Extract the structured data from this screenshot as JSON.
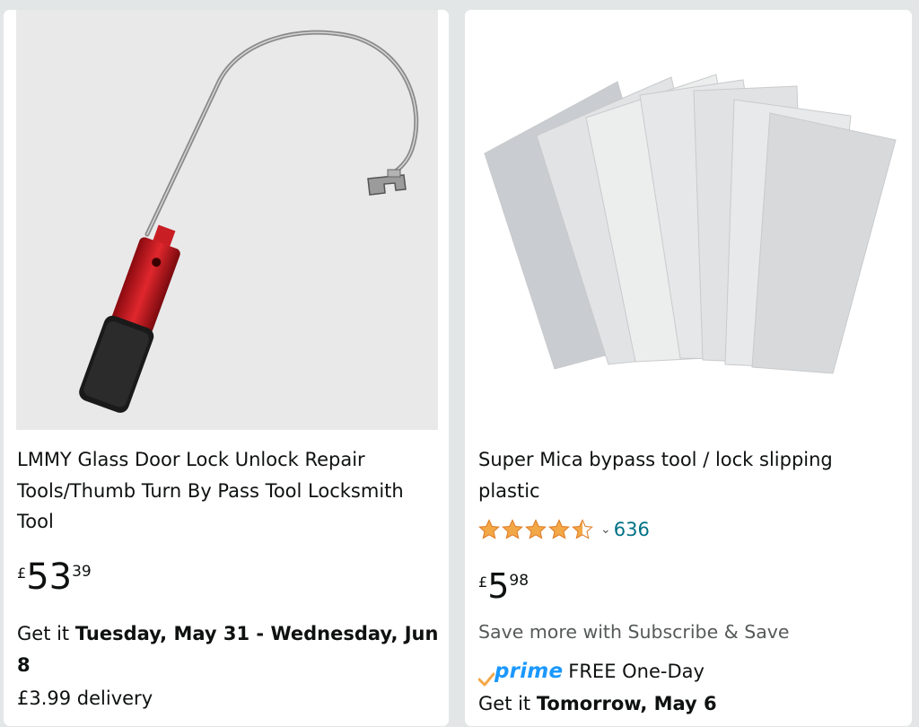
{
  "products": [
    {
      "title": "LMMY Glass Door Lock Unlock Repair Tools/Thumb Turn By Pass Tool Locksmith Tool",
      "price": {
        "currency": "£",
        "whole": "53",
        "fraction": "39"
      },
      "delivery_prefix": "Get it ",
      "delivery_date": "Tuesday, May 31 - Wednesday, Jun 8",
      "delivery_cost": "£3.99 delivery"
    },
    {
      "title": "Super Mica bypass tool / lock slipping plastic",
      "rating": {
        "stars": 4.5,
        "count": "636"
      },
      "price": {
        "currency": "£",
        "whole": "5",
        "fraction": "98"
      },
      "subscribe_text": "Save more with Subscribe & Save",
      "prime_label": "prime",
      "prime_text": "FREE One-Day",
      "delivery_prefix": "Get it ",
      "delivery_date": "Tomorrow, May 6"
    }
  ],
  "colors": {
    "star": "#f3a847",
    "link": "#007185",
    "prime": "#1a98ff"
  }
}
